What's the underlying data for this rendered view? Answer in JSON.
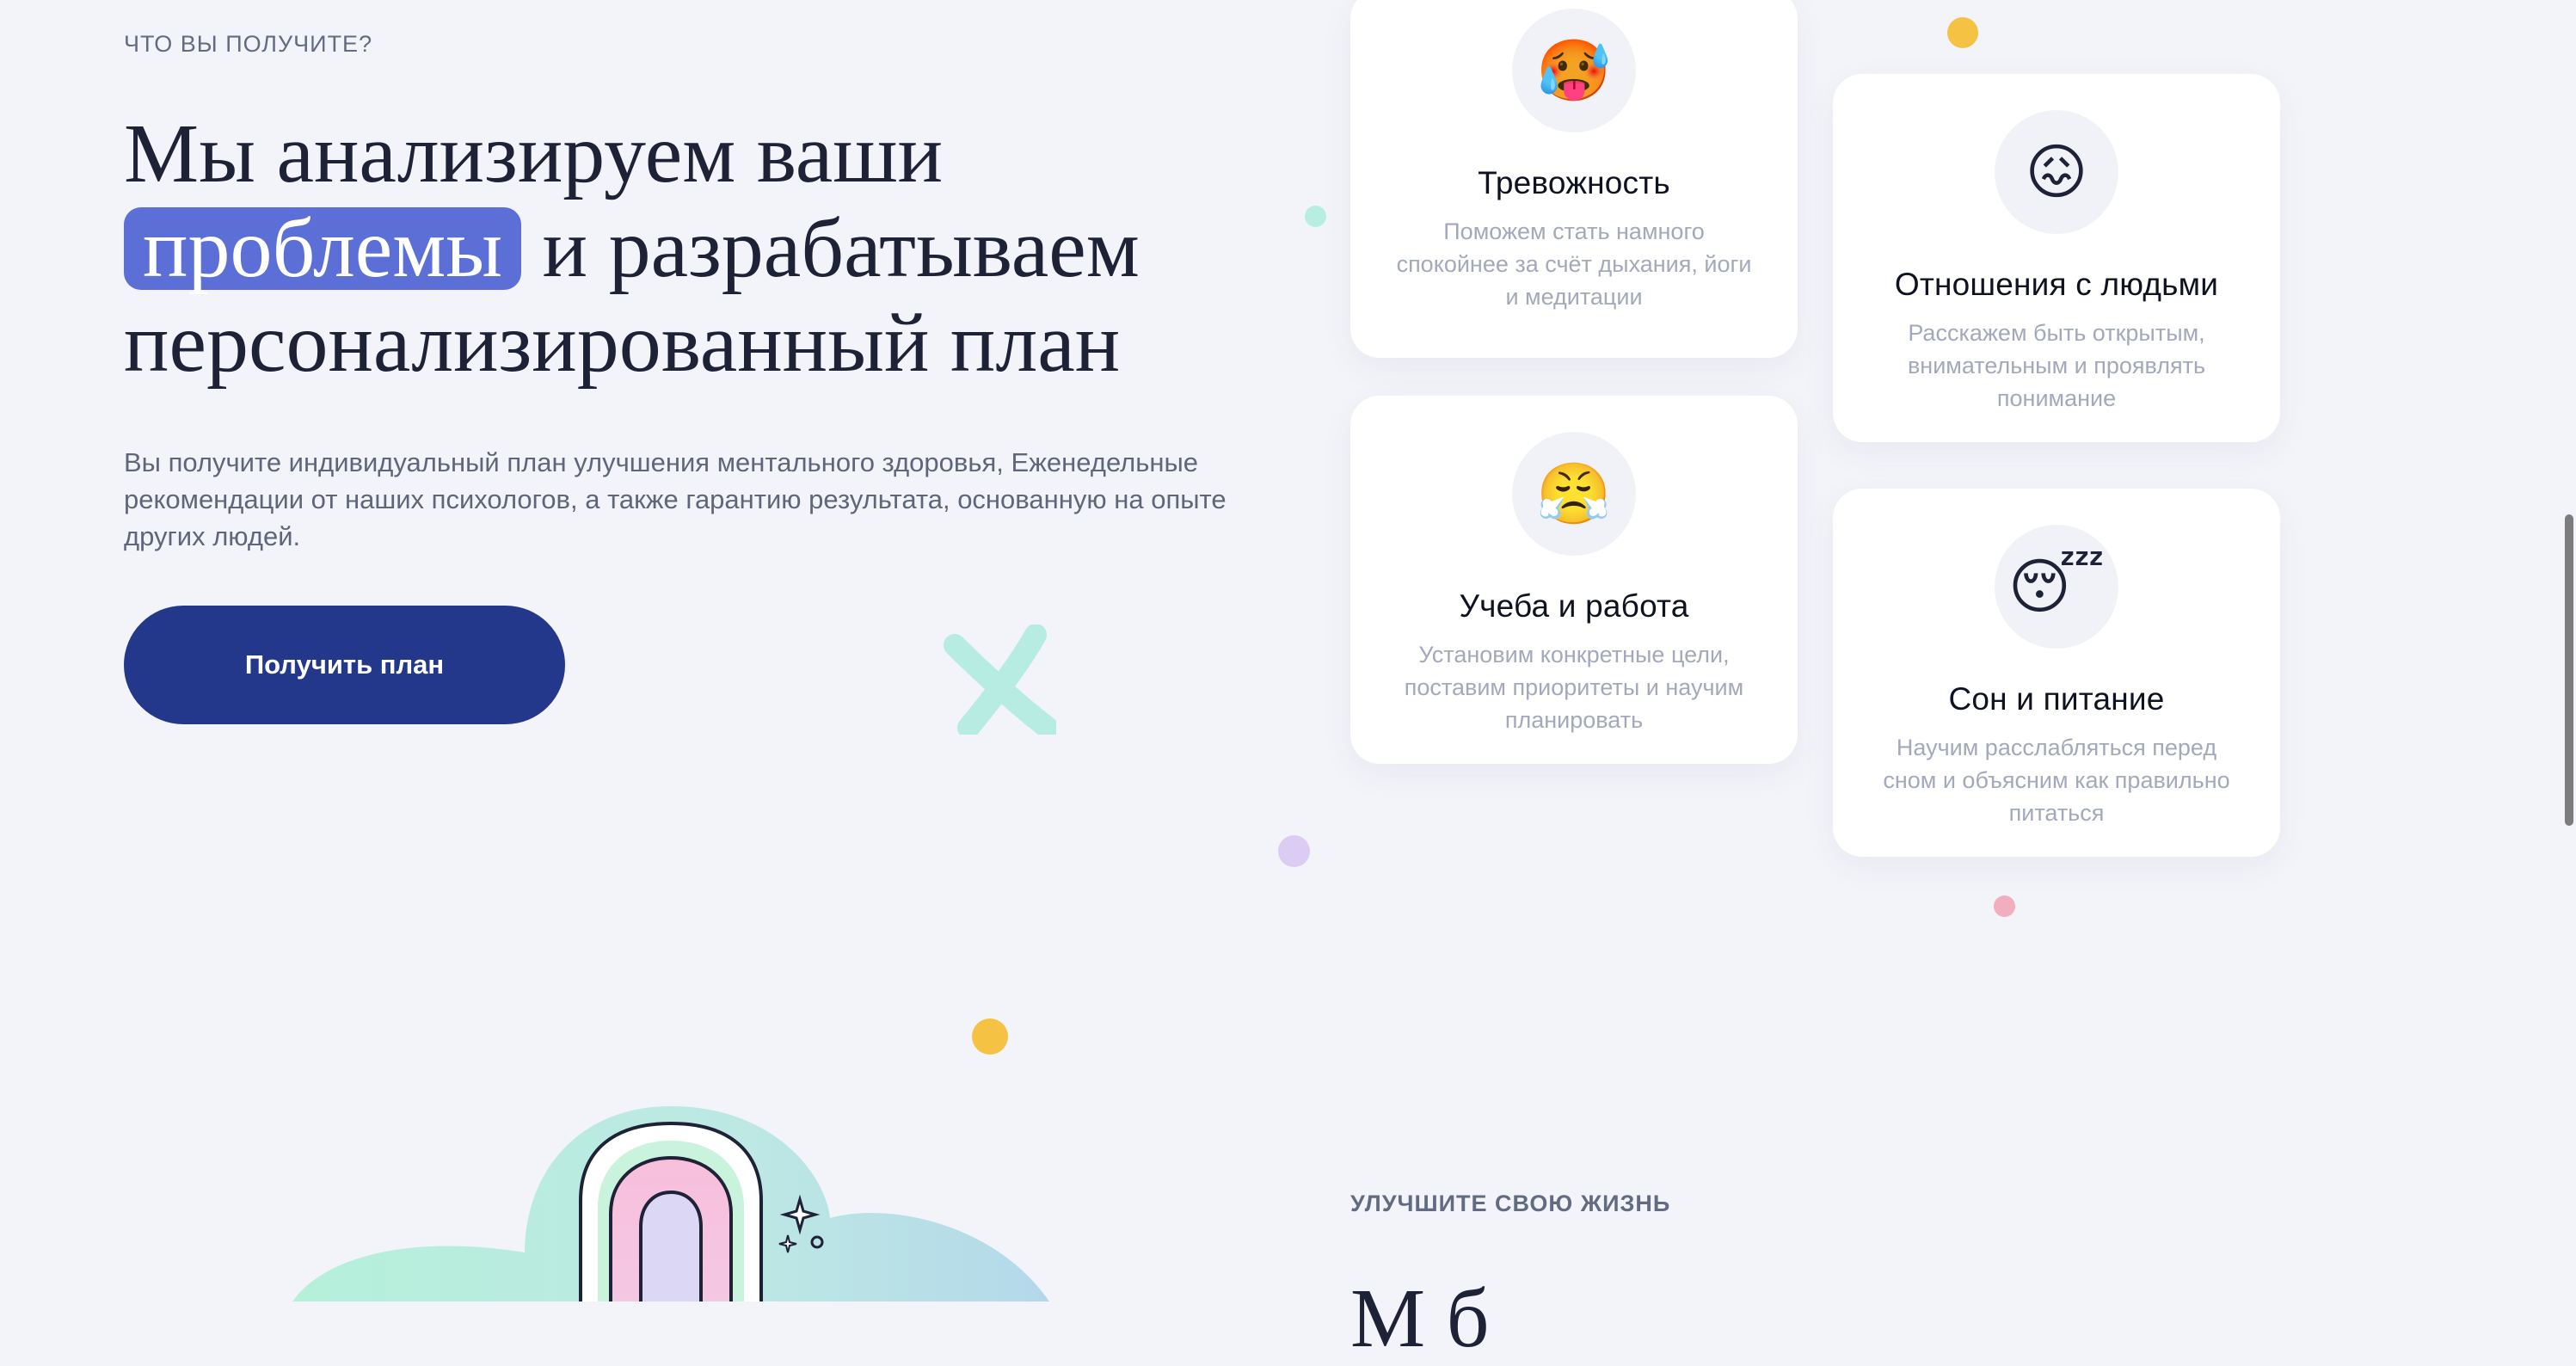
{
  "section1": {
    "eyebrow": "ЧТО ВЫ ПОЛУЧИТЕ?",
    "headline_part1": "Мы анализируем ваши",
    "headline_highlight": "проблемы",
    "headline_part2": "и разрабатываем персонализированный план",
    "description": "Вы получите индивидуальный план улучшения ментального здоровья, Еженедельные рекомендации от наших психологов, а также гарантию результата, основанную на опыте других людей.",
    "cta_label": "Получить план"
  },
  "cards": [
    {
      "icon": "hot-face-icon",
      "emoji": "🥵",
      "title": "Тревожность",
      "text": "Поможем стать намного спокойнее за счёт дыхания, йоги и медитации"
    },
    {
      "icon": "confounded-face-icon",
      "emoji": "😖",
      "title": "Отношения с людьми",
      "text": "Расскажем быть открытым, внимательным и проявлять понимание"
    },
    {
      "icon": "steam-face-icon",
      "emoji": "😤",
      "title": "Учеба и работа",
      "text": "Установим конкретные цели, поставим приоритеты и научим планировать"
    },
    {
      "icon": "sleeping-face-icon",
      "emoji": "😴",
      "title": "Сон и питание",
      "text": "Научим расслабляться перед сном и объясним как правильно питаться"
    }
  ],
  "section2": {
    "eyebrow": "УЛУЧШИТЕ СВОЮ ЖИЗНЬ",
    "headline_fragment": "М                 б"
  },
  "colors": {
    "background": "#f3f4f9",
    "highlight": "#5b6fd6",
    "cta": "#24388b",
    "dot_yellow": "#f6c244",
    "dot_mint": "#b4ede0",
    "dot_lilac": "#dccbf3",
    "dot_pink": "#f3aebe"
  }
}
